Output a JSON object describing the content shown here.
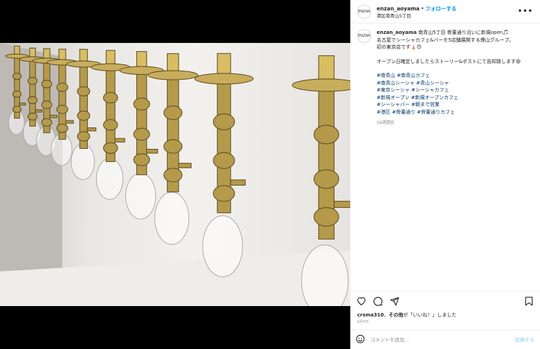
{
  "post": {
    "username": "enzan_aoyama",
    "separator": "•",
    "follow_label": "フォローする",
    "location": "港区南青山5丁目",
    "avatar_text": "ENZAN",
    "more_label": "•••"
  },
  "caption": {
    "username": "enzan_aoyama",
    "line1": "南青山5丁目 骨董通り沿いに新規open🎵",
    "line2": "名古屋でシーシャカフェ&バーを5店舗展開する煙山グループ。",
    "line3": "初の東京店です🗼😊",
    "line4": "オープン日確定しましたらストーリー&ポストにて告知致します😆",
    "hashtags": [
      "#南青山 #南青山カフェ",
      "#南青山シーシャ #青山シーシャ",
      "#東京シーシャ #シーシャカフェ",
      "#新規オープン #新規オープンカフェ",
      "#シーシャバー #朝まで営業",
      "#港区 #骨董通り #骨董通りカフェ"
    ],
    "time_ago": "16週間前"
  },
  "likes": {
    "user": "crsma310",
    "connector": "、",
    "others": "その他",
    "suffix": "が「いいね！」しました"
  },
  "date_label": "6月4日",
  "comment": {
    "placeholder": "コメントを追加...",
    "post_label": "投稿する"
  },
  "colors": {
    "link_blue": "#0095f6",
    "hashtag_blue": "#00376b",
    "muted": "#8e8e8e",
    "brass": "#b59a4a"
  }
}
